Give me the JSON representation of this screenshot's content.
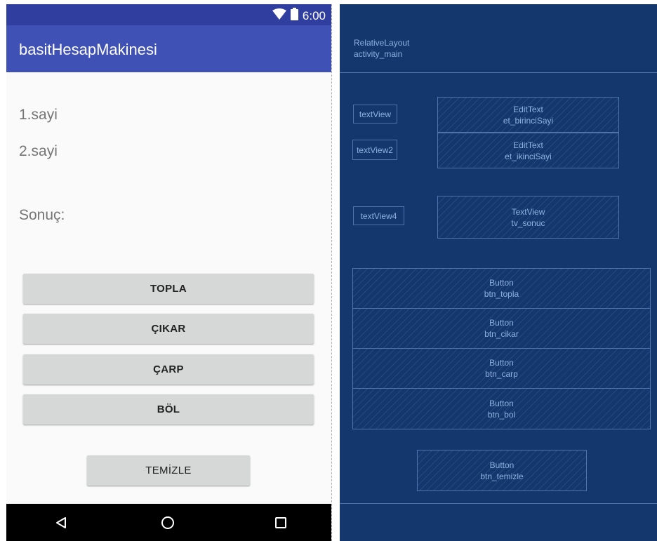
{
  "status_bar": {
    "time": "6:00",
    "wifi_icon": "wifi-icon",
    "battery_icon": "battery-icon"
  },
  "app_bar": {
    "title": "basitHesapMakinesi"
  },
  "labels": {
    "first_number": "1.sayi",
    "second_number": "2.sayi",
    "result": "Sonuç:"
  },
  "buttons": {
    "add": "TOPLA",
    "subtract": "ÇIKAR",
    "multiply": "ÇARP",
    "divide": "BÖL",
    "clear": "TEMİZLE"
  },
  "nav_bar": {
    "back_icon": "back-icon",
    "home_icon": "home-icon",
    "recents_icon": "recents-icon"
  },
  "blueprint": {
    "root": {
      "type": "RelativeLayout",
      "id": "activity_main"
    },
    "textviews": {
      "tv1": "textView",
      "tv2": "textView2",
      "tv4": "textView4"
    },
    "et1": {
      "type": "EditText",
      "id": "et_birinciSayi"
    },
    "et2": {
      "type": "EditText",
      "id": "et_ikinciSayi"
    },
    "tv_result": {
      "type": "TextView",
      "id": "tv_sonuc"
    },
    "btn_add": {
      "type": "Button",
      "id": "btn_topla"
    },
    "btn_sub": {
      "type": "Button",
      "id": "btn_cikar"
    },
    "btn_mul": {
      "type": "Button",
      "id": "btn_carp"
    },
    "btn_div": {
      "type": "Button",
      "id": "btn_bol"
    },
    "btn_clear": {
      "type": "Button",
      "id": "btn_temizle"
    }
  },
  "colors": {
    "status_bar": "#303f9f",
    "app_bar": "#3f51b5",
    "blueprint_bg": "#14386e",
    "blueprint_line": "#4f74ab",
    "button_bg": "#d6d7d7"
  }
}
